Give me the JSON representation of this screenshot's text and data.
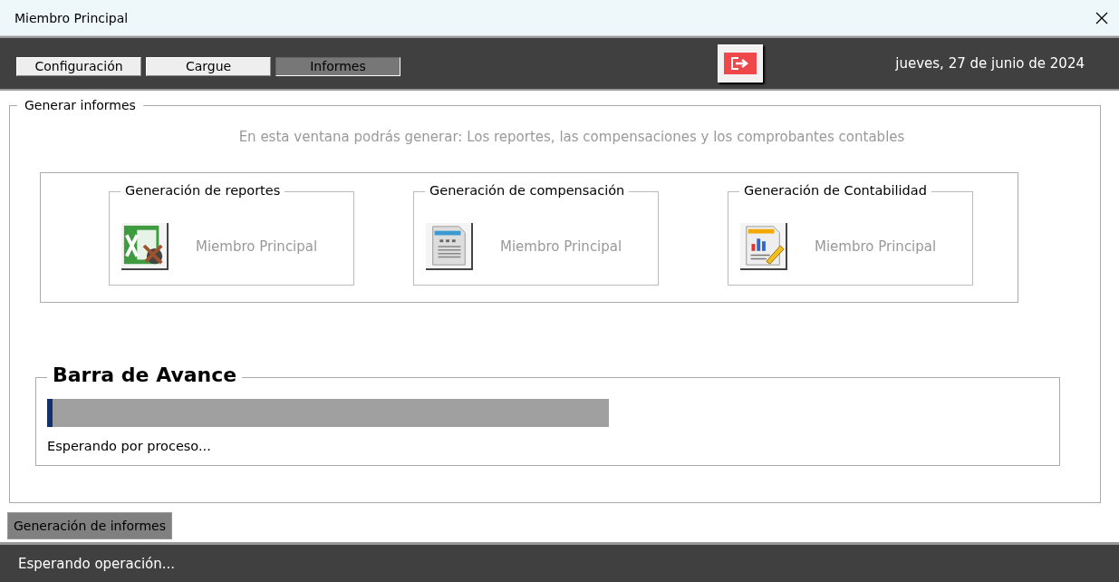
{
  "window": {
    "title": "Miembro Principal"
  },
  "tabs": [
    {
      "label": "Configuración",
      "selected": false
    },
    {
      "label": "Cargue",
      "selected": false
    },
    {
      "label": "Informes",
      "selected": true
    }
  ],
  "date": "jueves, 27 de junio de 2024",
  "main": {
    "legend": "Generar informes",
    "intro": "En esta ventana podrás generar: Los reportes, las compensaciones y los comprobantes contables",
    "cards": [
      {
        "kind": "excel",
        "title": "Generación de reportes",
        "label": "Miembro Principal"
      },
      {
        "kind": "document",
        "title": "Generación de compensación",
        "label": "Miembro Principal"
      },
      {
        "kind": "report",
        "title": "Generación de Contabilidad",
        "label": "Miembro Principal"
      }
    ]
  },
  "progress": {
    "title": "Barra de Avance",
    "level": 0.01,
    "message": "Esperando por proceso..."
  },
  "bottom_tabs": [
    {
      "label": "Generación de informes",
      "selected": true
    }
  ],
  "status_bar": "Esperando operación..."
}
